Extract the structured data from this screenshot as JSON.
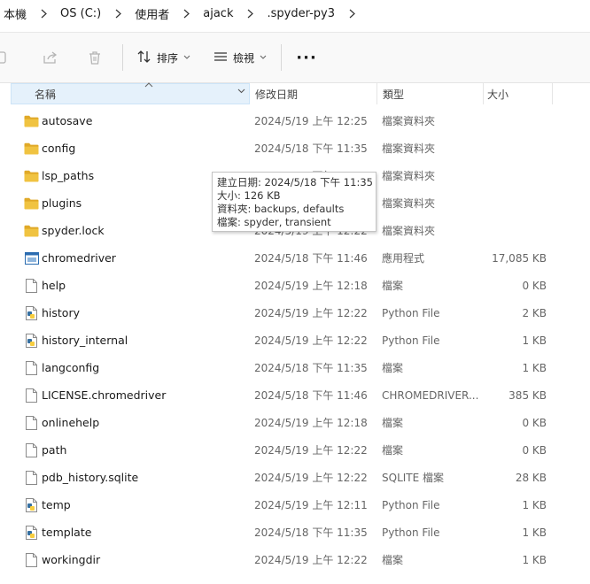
{
  "breadcrumb": [
    "本機",
    "OS (C:)",
    "使用者",
    "ajack",
    ".spyder-py3"
  ],
  "toolbar": {
    "sort_label": "排序",
    "view_label": "檢視",
    "more_label": "···"
  },
  "columns": {
    "name": "名稱",
    "date": "修改日期",
    "type": "類型",
    "size": "大小"
  },
  "files": [
    {
      "name": "autosave",
      "date": "2024/5/19 上午 12:25",
      "type": "檔案資料夾",
      "size": "",
      "icon": "folder-icon"
    },
    {
      "name": "config",
      "date": "2024/5/18 下午 11:35",
      "type": "檔案資料夾",
      "size": "",
      "icon": "folder-icon"
    },
    {
      "name": "lsp_paths",
      "date": "2024/5/18 下午 11:35",
      "type": "檔案資料夾",
      "size": "",
      "icon": "folder-icon"
    },
    {
      "name": "plugins",
      "date": "2024/5/18 下午 11:35",
      "type": "檔案資料夾",
      "size": "",
      "icon": "folder-icon"
    },
    {
      "name": "spyder.lock",
      "date": "2024/5/19 上午 12:22",
      "type": "檔案資料夾",
      "size": "",
      "icon": "folder-icon"
    },
    {
      "name": "chromedriver",
      "date": "2024/5/18 下午 11:46",
      "type": "應用程式",
      "size": "17,085 KB",
      "icon": "application-icon"
    },
    {
      "name": "help",
      "date": "2024/5/19 上午 12:18",
      "type": "檔案",
      "size": "0 KB",
      "icon": "file-icon"
    },
    {
      "name": "history",
      "date": "2024/5/19 上午 12:22",
      "type": "Python File",
      "size": "2 KB",
      "icon": "python-file-icon"
    },
    {
      "name": "history_internal",
      "date": "2024/5/19 上午 12:22",
      "type": "Python File",
      "size": "1 KB",
      "icon": "python-file-icon"
    },
    {
      "name": "langconfig",
      "date": "2024/5/18 下午 11:35",
      "type": "檔案",
      "size": "1 KB",
      "icon": "file-icon"
    },
    {
      "name": "LICENSE.chromedriver",
      "date": "2024/5/18 下午 11:46",
      "type": "CHROMEDRIVER...",
      "size": "385 KB",
      "icon": "file-icon"
    },
    {
      "name": "onlinehelp",
      "date": "2024/5/19 上午 12:18",
      "type": "檔案",
      "size": "0 KB",
      "icon": "file-icon"
    },
    {
      "name": "path",
      "date": "2024/5/19 上午 12:22",
      "type": "檔案",
      "size": "0 KB",
      "icon": "file-icon"
    },
    {
      "name": "pdb_history.sqlite",
      "date": "2024/5/19 上午 12:22",
      "type": "SQLITE 檔案",
      "size": "28 KB",
      "icon": "file-icon"
    },
    {
      "name": "temp",
      "date": "2024/5/19 上午 12:11",
      "type": "Python File",
      "size": "1 KB",
      "icon": "python-file-icon"
    },
    {
      "name": "template",
      "date": "2024/5/18 下午 11:35",
      "type": "Python File",
      "size": "1 KB",
      "icon": "python-file-icon"
    },
    {
      "name": "workingdir",
      "date": "2024/5/19 上午 12:22",
      "type": "檔案",
      "size": "1 KB",
      "icon": "file-icon"
    }
  ],
  "tooltip": {
    "created": "建立日期: 2024/5/18 下午 11:35",
    "size": "大小: 126 KB",
    "folders": "資料夾: backups, defaults",
    "files": "檔案: spyder, transient"
  },
  "colors": {
    "folder": "#f0c341",
    "folder_dark": "#e0a928",
    "header_highlight": "#e5f1fb",
    "python_blue": "#3670a0",
    "python_yellow": "#f7cd3f"
  }
}
